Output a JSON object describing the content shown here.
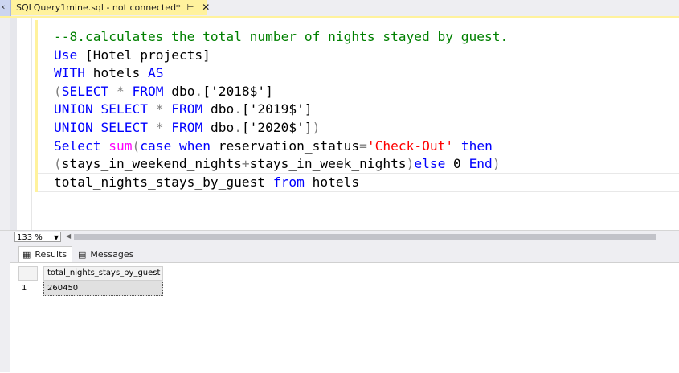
{
  "tab": {
    "title": "SQLQuery1mine.sql - not connected*",
    "pin_icon": "pin-icon",
    "close_icon": "close-icon"
  },
  "editor": {
    "lines": [
      [
        {
          "t": "--8.calculates the total number of nights stayed by guest.",
          "c": "comment"
        }
      ],
      [
        {
          "t": "Use",
          "c": "kw"
        },
        {
          "t": " [Hotel projects]",
          "c": "plain"
        }
      ],
      [
        {
          "t": "WITH",
          "c": "kw"
        },
        {
          "t": " hotels ",
          "c": "plain"
        },
        {
          "t": "AS",
          "c": "kw"
        }
      ],
      [
        {
          "t": "(",
          "c": "gray"
        },
        {
          "t": "SELECT",
          "c": "kw"
        },
        {
          "t": " ",
          "c": "plain"
        },
        {
          "t": "*",
          "c": "gray"
        },
        {
          "t": " ",
          "c": "plain"
        },
        {
          "t": "FROM",
          "c": "kw"
        },
        {
          "t": " dbo",
          "c": "plain"
        },
        {
          "t": ".",
          "c": "gray"
        },
        {
          "t": "['2018$']",
          "c": "plain"
        }
      ],
      [
        {
          "t": "UNION",
          "c": "kw"
        },
        {
          "t": " ",
          "c": "plain"
        },
        {
          "t": "SELECT",
          "c": "kw"
        },
        {
          "t": " ",
          "c": "plain"
        },
        {
          "t": "*",
          "c": "gray"
        },
        {
          "t": " ",
          "c": "plain"
        },
        {
          "t": "FROM",
          "c": "kw"
        },
        {
          "t": " dbo",
          "c": "plain"
        },
        {
          "t": ".",
          "c": "gray"
        },
        {
          "t": "['2019$']",
          "c": "plain"
        }
      ],
      [
        {
          "t": "UNION",
          "c": "kw"
        },
        {
          "t": " ",
          "c": "plain"
        },
        {
          "t": "SELECT",
          "c": "kw"
        },
        {
          "t": " ",
          "c": "plain"
        },
        {
          "t": "*",
          "c": "gray"
        },
        {
          "t": " ",
          "c": "plain"
        },
        {
          "t": "FROM",
          "c": "kw"
        },
        {
          "t": " dbo",
          "c": "plain"
        },
        {
          "t": ".",
          "c": "gray"
        },
        {
          "t": "['2020$']",
          "c": "plain"
        },
        {
          "t": ")",
          "c": "gray"
        }
      ],
      [
        {
          "t": "Select",
          "c": "kw"
        },
        {
          "t": " ",
          "c": "plain"
        },
        {
          "t": "sum",
          "c": "fn"
        },
        {
          "t": "(",
          "c": "gray"
        },
        {
          "t": "case",
          "c": "kw"
        },
        {
          "t": " ",
          "c": "plain"
        },
        {
          "t": "when",
          "c": "kw"
        },
        {
          "t": " reservation_status",
          "c": "plain"
        },
        {
          "t": "=",
          "c": "gray"
        },
        {
          "t": "'Check-Out'",
          "c": "str"
        },
        {
          "t": " ",
          "c": "plain"
        },
        {
          "t": "then",
          "c": "kw"
        }
      ],
      [
        {
          "t": "(",
          "c": "gray"
        },
        {
          "t": "stays_in_weekend_nights",
          "c": "plain"
        },
        {
          "t": "+",
          "c": "gray"
        },
        {
          "t": "stays_in_week_nights",
          "c": "plain"
        },
        {
          "t": ")",
          "c": "gray"
        },
        {
          "t": "else",
          "c": "kw"
        },
        {
          "t": " 0 ",
          "c": "plain"
        },
        {
          "t": "End",
          "c": "kw"
        },
        {
          "t": ")",
          "c": "gray"
        }
      ],
      [
        {
          "t": "total_nights_stays_by_guest ",
          "c": "plain"
        },
        {
          "t": "from",
          "c": "kw"
        },
        {
          "t": " hotels",
          "c": "plain"
        }
      ]
    ]
  },
  "zoom": {
    "value": "133 %"
  },
  "results": {
    "tabs": [
      {
        "label": "Results",
        "icon": "grid-icon"
      },
      {
        "label": "Messages",
        "icon": "messages-icon"
      }
    ],
    "columns": [
      "total_nights_stays_by_guest"
    ],
    "rows": [
      {
        "num": "1",
        "values": [
          "260450"
        ]
      }
    ]
  },
  "colors": {
    "tab_active": "#fff29d",
    "keyword": "#0000ff",
    "comment": "#008000",
    "string": "#ff0000",
    "function": "#ff00ff",
    "operator": "#808080"
  }
}
